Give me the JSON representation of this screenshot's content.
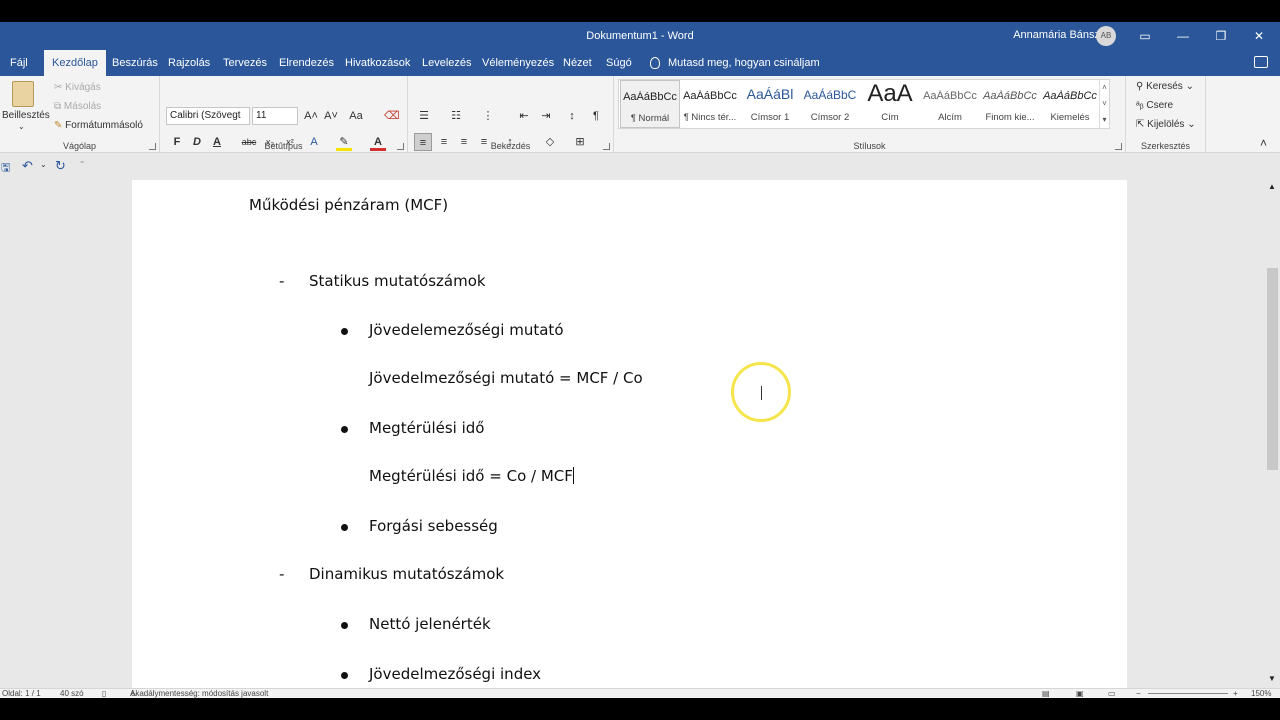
{
  "window": {
    "title": "Dokumentum1  -  Word",
    "user": "Annamária Bánszki",
    "avatar": "AB"
  },
  "tabs": [
    "Fájl",
    "Kezdőlap",
    "Beszúrás",
    "Rajzolás",
    "Tervezés",
    "Elrendezés",
    "Hivatkozások",
    "Levelezés",
    "Véleményezés",
    "Nézet",
    "Súgó"
  ],
  "tell_me": "Mutasd meg, hogyan csináljam",
  "ribbon": {
    "clipboard": {
      "paste": "Beillesztés",
      "cut": "Kivágás",
      "copy": "Másolás",
      "format_painter": "Formátummásoló",
      "label": "Vágólap"
    },
    "font": {
      "name": "Calibri (Szövegt",
      "size": "11",
      "label": "Betűtípus",
      "bold": "F",
      "italic": "D",
      "underline": "A"
    },
    "paragraph": {
      "label": "Bekezdés"
    },
    "styles": {
      "label": "Stílusok",
      "items": [
        {
          "preview": "AaÁáBbCc",
          "name": "¶ Normál"
        },
        {
          "preview": "AaÁáBbCc",
          "name": "¶ Nincs tér..."
        },
        {
          "preview": "AaÁáBl",
          "name": "Címsor 1"
        },
        {
          "preview": "AaÁáBbC",
          "name": "Címsor 2"
        },
        {
          "preview": "AaA",
          "name": "Cím"
        },
        {
          "preview": "AaÁáBbCc",
          "name": "Alcím"
        },
        {
          "preview": "AaÁáBbCc",
          "name": "Finom kie..."
        },
        {
          "preview": "AaÁáBbCc",
          "name": "Kiemelés"
        }
      ]
    },
    "editing": {
      "find": "Keresés",
      "replace": "Csere",
      "select": "Kijelölés",
      "label": "Szerkesztés"
    }
  },
  "document": {
    "heading": "Működési pénzáram (MCF)",
    "dash1": "-",
    "section1": "Statikus mutatószámok",
    "item1": "Jövedelemezőségi mutató",
    "formula1": "Jövedelmezőségi mutató = MCF / Co",
    "item2": "Megtérülési idő",
    "formula2": "Megtérülési idő = Co / MCF",
    "item3": "Forgási sebesség",
    "dash2": "-",
    "section2": "Dinamikus mutatószámok",
    "item4": "Nettó jelenérték",
    "item5": "Jövedelmezőségi index"
  },
  "status": {
    "page": "Oldal: 1 / 1",
    "words": "40 szó",
    "accessibility": "Akadálymentesség: módosítás javasolt",
    "zoom": "150%"
  }
}
